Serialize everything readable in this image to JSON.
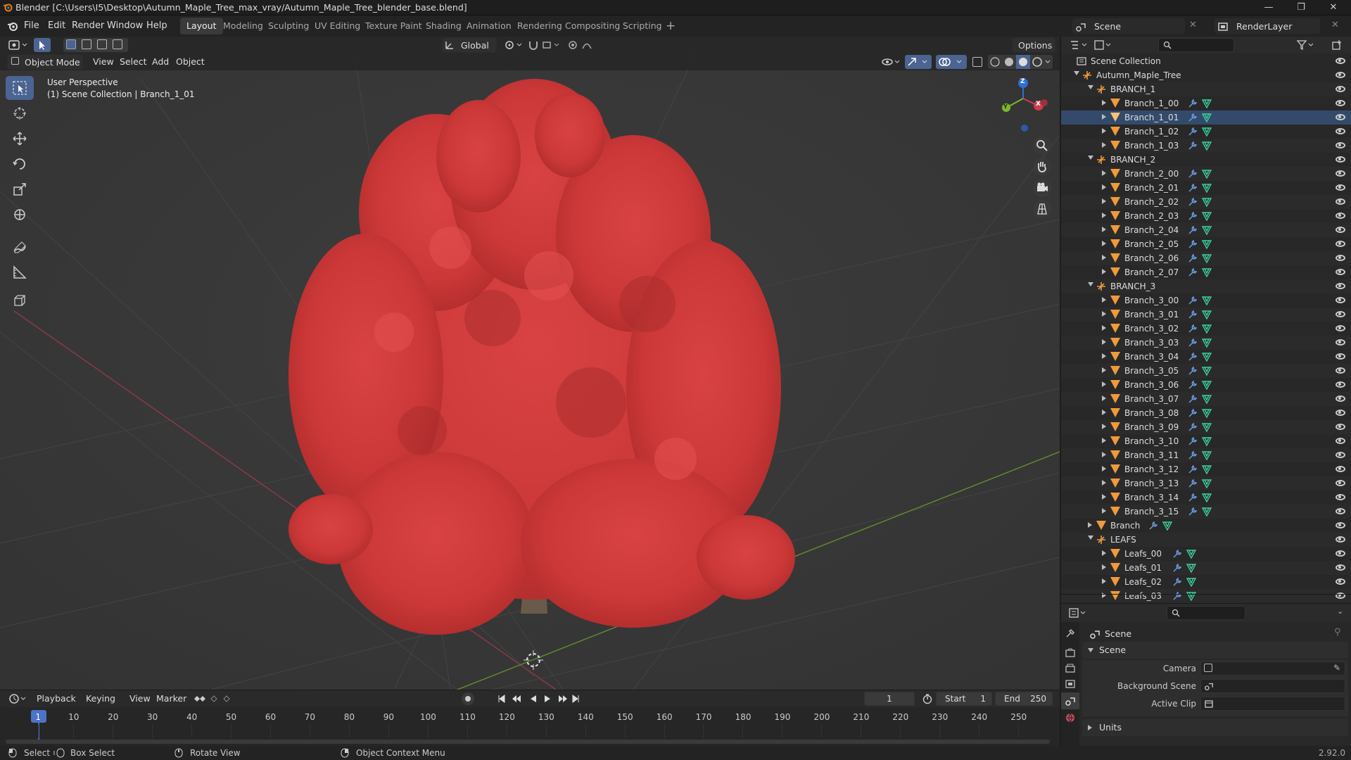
{
  "window": {
    "title": "Blender [C:\\Users\\I5\\Desktop\\Autumn_Maple_Tree_max_vray/Autumn_Maple_Tree_blender_base.blend]",
    "controls": [
      "—",
      "❐",
      "✕"
    ]
  },
  "menu": [
    "File",
    "Edit",
    "Render",
    "Window",
    "Help"
  ],
  "workspaces": [
    "Layout",
    "Modeling",
    "Sculpting",
    "UV Editing",
    "Texture Paint",
    "Shading",
    "Animation",
    "Rendering",
    "Compositing",
    "Scripting"
  ],
  "active_workspace": "Layout",
  "scene_selector": "Scene",
  "view_layer_selector": "RenderLayer",
  "viewport_header": {
    "transform_orientation": "Global",
    "options_label": "Options",
    "mode": "Object Mode",
    "menus": [
      "View",
      "Select",
      "Add",
      "Object"
    ]
  },
  "viewport": {
    "view_name": "User Perspective",
    "collection_info": "(1) Scene Collection | Branch_1_01"
  },
  "gizmo_axes": {
    "z": "Z",
    "x": "X",
    "y": "Y"
  },
  "outliner": {
    "root": "Scene Collection",
    "rows": [
      {
        "label": "Autumn_Maple_Tree",
        "level": 0,
        "type": "empty",
        "expanded": true
      },
      {
        "label": "BRANCH_1",
        "level": 1,
        "type": "empty",
        "expanded": true
      },
      {
        "label": "Branch_1_00",
        "level": 2,
        "type": "mesh"
      },
      {
        "label": "Branch_1_01",
        "level": 2,
        "type": "mesh",
        "active": true
      },
      {
        "label": "Branch_1_02",
        "level": 2,
        "type": "mesh"
      },
      {
        "label": "Branch_1_03",
        "level": 2,
        "type": "mesh"
      },
      {
        "label": "BRANCH_2",
        "level": 1,
        "type": "empty",
        "expanded": true
      },
      {
        "label": "Branch_2_00",
        "level": 2,
        "type": "mesh"
      },
      {
        "label": "Branch_2_01",
        "level": 2,
        "type": "mesh"
      },
      {
        "label": "Branch_2_02",
        "level": 2,
        "type": "mesh"
      },
      {
        "label": "Branch_2_03",
        "level": 2,
        "type": "mesh"
      },
      {
        "label": "Branch_2_04",
        "level": 2,
        "type": "mesh"
      },
      {
        "label": "Branch_2_05",
        "level": 2,
        "type": "mesh"
      },
      {
        "label": "Branch_2_06",
        "level": 2,
        "type": "mesh"
      },
      {
        "label": "Branch_2_07",
        "level": 2,
        "type": "mesh"
      },
      {
        "label": "BRANCH_3",
        "level": 1,
        "type": "empty",
        "expanded": true
      },
      {
        "label": "Branch_3_00",
        "level": 2,
        "type": "mesh"
      },
      {
        "label": "Branch_3_01",
        "level": 2,
        "type": "mesh"
      },
      {
        "label": "Branch_3_02",
        "level": 2,
        "type": "mesh"
      },
      {
        "label": "Branch_3_03",
        "level": 2,
        "type": "mesh"
      },
      {
        "label": "Branch_3_04",
        "level": 2,
        "type": "mesh"
      },
      {
        "label": "Branch_3_05",
        "level": 2,
        "type": "mesh"
      },
      {
        "label": "Branch_3_06",
        "level": 2,
        "type": "mesh"
      },
      {
        "label": "Branch_3_07",
        "level": 2,
        "type": "mesh"
      },
      {
        "label": "Branch_3_08",
        "level": 2,
        "type": "mesh"
      },
      {
        "label": "Branch_3_09",
        "level": 2,
        "type": "mesh"
      },
      {
        "label": "Branch_3_10",
        "level": 2,
        "type": "mesh"
      },
      {
        "label": "Branch_3_11",
        "level": 2,
        "type": "mesh"
      },
      {
        "label": "Branch_3_12",
        "level": 2,
        "type": "mesh"
      },
      {
        "label": "Branch_3_13",
        "level": 2,
        "type": "mesh"
      },
      {
        "label": "Branch_3_14",
        "level": 2,
        "type": "mesh"
      },
      {
        "label": "Branch_3_15",
        "level": 2,
        "type": "mesh"
      },
      {
        "label": "Branch",
        "level": 1,
        "type": "mesh",
        "collapsed": true
      },
      {
        "label": "LEAFS",
        "level": 1,
        "type": "empty",
        "expanded": true
      },
      {
        "label": "Leafs_00",
        "level": 2,
        "type": "mesh"
      },
      {
        "label": "Leafs_01",
        "level": 2,
        "type": "mesh"
      },
      {
        "label": "Leafs_02",
        "level": 2,
        "type": "mesh"
      },
      {
        "label": "Leafs_03",
        "level": 2,
        "type": "mesh"
      }
    ]
  },
  "properties": {
    "context": "Scene",
    "panel": "Scene",
    "fields": [
      {
        "label": "Camera",
        "value": ""
      },
      {
        "label": "Background Scene",
        "value": ""
      },
      {
        "label": "Active Clip",
        "value": ""
      }
    ],
    "collapsed_panel": "Units"
  },
  "timeline": {
    "menus": [
      "Playback",
      "Keying",
      "View",
      "Marker"
    ],
    "current_frame": "1",
    "start_label": "Start",
    "start": "1",
    "end_label": "End",
    "end": "250",
    "ticks": [
      "1",
      "10",
      "20",
      "30",
      "40",
      "50",
      "60",
      "70",
      "80",
      "90",
      "100",
      "110",
      "120",
      "130",
      "140",
      "150",
      "160",
      "170",
      "180",
      "190",
      "200",
      "210",
      "220",
      "230",
      "240",
      "250"
    ]
  },
  "statusbar": {
    "select": "Select",
    "box_select": "Box Select",
    "rotate_view": "Rotate View",
    "context_menu": "Object Context Menu",
    "version": "2.92.0"
  },
  "colors": {
    "accent_blue": "#4b6491",
    "foliage": "#d23a3a",
    "mesh_icon": "#f09a3a",
    "modifier_icon": "#6b9ce0",
    "data_icon": "#3ccf9a",
    "x_axis": "#cf3c4c",
    "y_axis": "#7bb82c",
    "z_axis": "#2f6fd6"
  }
}
